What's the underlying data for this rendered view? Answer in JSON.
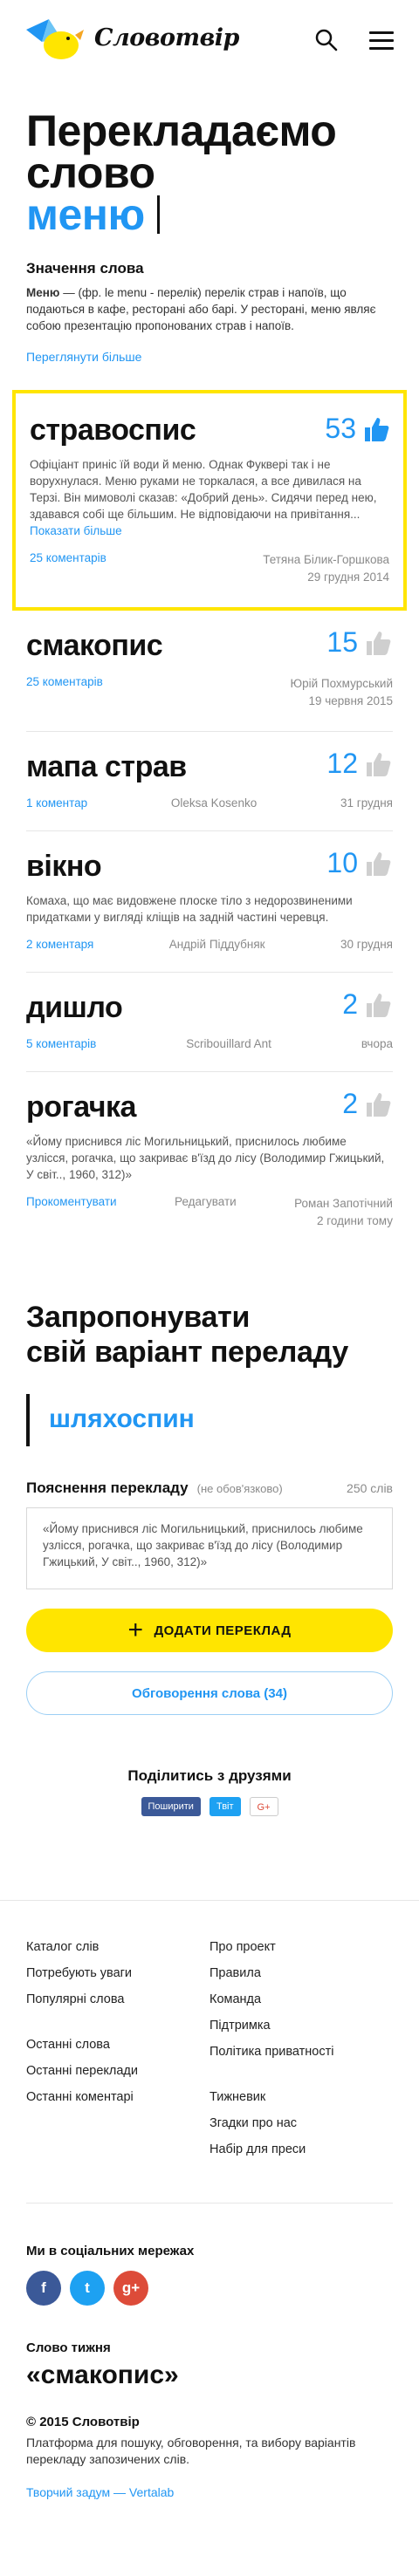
{
  "header": {
    "logo_text": "Словотвір"
  },
  "title": {
    "line1": "Перекладаємо",
    "line2": "слово",
    "word": "меню"
  },
  "meaning": {
    "heading": "Значення слова",
    "term": "Меню",
    "text": " — (фр. le menu - перелік) перелік страв і напоїв, що подаються в кафе, ресторані або барі. У ресторані, меню являє собою презентацію пропонованих страв і напоїв.",
    "more": "Переглянути більше"
  },
  "cards": [
    {
      "word": "стравоспис",
      "score": "53",
      "featured": true,
      "desc": "Офіціант приніс їй води й меню. Однак Фуквері так і не ворухнулася. Меню руками не торкалася, а все дивилася на Терзі. Він мимоволі сказав: «Добрий день». Сидячи перед нею, здавався собі ще більшим. Не відповідаючи на привітання... ",
      "more": "Показати більше",
      "comments": "25 коментарів",
      "author": "Тетяна Білик-Горшкова",
      "date": "29 грудня 2014"
    },
    {
      "word": "смакопис",
      "score": "15",
      "comments": "25 коментарів",
      "author": "Юрій Похмурський",
      "date": "19 червня 2015"
    },
    {
      "word": "мапа страв",
      "score": "12",
      "comments": "1 коментар",
      "author": "Oleksa Kosenko",
      "date": "31 грудня"
    },
    {
      "word": "вікно",
      "score": "10",
      "desc": "Комаха, що має видовжене плоске тіло з недорозвиненими придатками у вигляді кліщів на задній частині черевця.",
      "comments": "2 коментаря",
      "author": "Андрій Піддубняк",
      "date": "30 грудня"
    },
    {
      "word": "дишло",
      "score": "2",
      "comments": "5 коментарів",
      "author": "Scribouillard Ant",
      "date": "вчора"
    },
    {
      "word": "рогачка",
      "score": "2",
      "desc": "«Йому приснився ліс Могильницький, приснилось любиме узлісся, рогачка, що закриває в'їзд до лісу (Володимир Гжицький, У світ.., 1960, 312)»",
      "comments": "Прокоментувати",
      "edit": "Редагувати",
      "author": "Роман Запотічний",
      "date": "2 години тому"
    }
  ],
  "suggest": {
    "heading_line1": "Запропонувати",
    "heading_line2": "свій варіант переладу",
    "input_value": "шляхоспин",
    "expl_label": "Пояснення перекладу",
    "expl_optional": "(не обов'язково)",
    "expl_count": "250 слів",
    "expl_value": "«Йому приснився ліс Могильницький, приснилось любиме узлісся, рогачка, що закриває в'їзд до лісу (Володимир Гжицький, У світ.., 1960, 312)»",
    "add_label": "ДОДАТИ ПЕРЕКЛАД",
    "discuss_label": "Обговорення слова (34)"
  },
  "share": {
    "heading": "Поділитись з друзями",
    "fb": "Поширити",
    "tw": "Твіт",
    "gp": "G+"
  },
  "footer": {
    "left": [
      "Каталог слів",
      "Потребують уваги",
      "Популярні слова",
      "",
      "Останні слова",
      "Останні переклади",
      "Останні коментарі"
    ],
    "right": [
      "Про проект",
      "Правила",
      "Команда",
      "Підтримка",
      "Політика приватності",
      "",
      "Тижневик",
      "Згадки про нас",
      "Набір для преси"
    ],
    "social_heading": "Ми в соціальних мережах",
    "week_heading": "Слово тижня",
    "week_word": "«смакопис»",
    "copyright": "© 2015 Словотвір",
    "about": "Платформа для пошуку, обговорення, та вибору варіантів перекладу запозичених слів.",
    "credit": "Творчий задум — Vertalab"
  },
  "colors": {
    "accent": "#2196f3",
    "highlight": "#ffe500"
  }
}
